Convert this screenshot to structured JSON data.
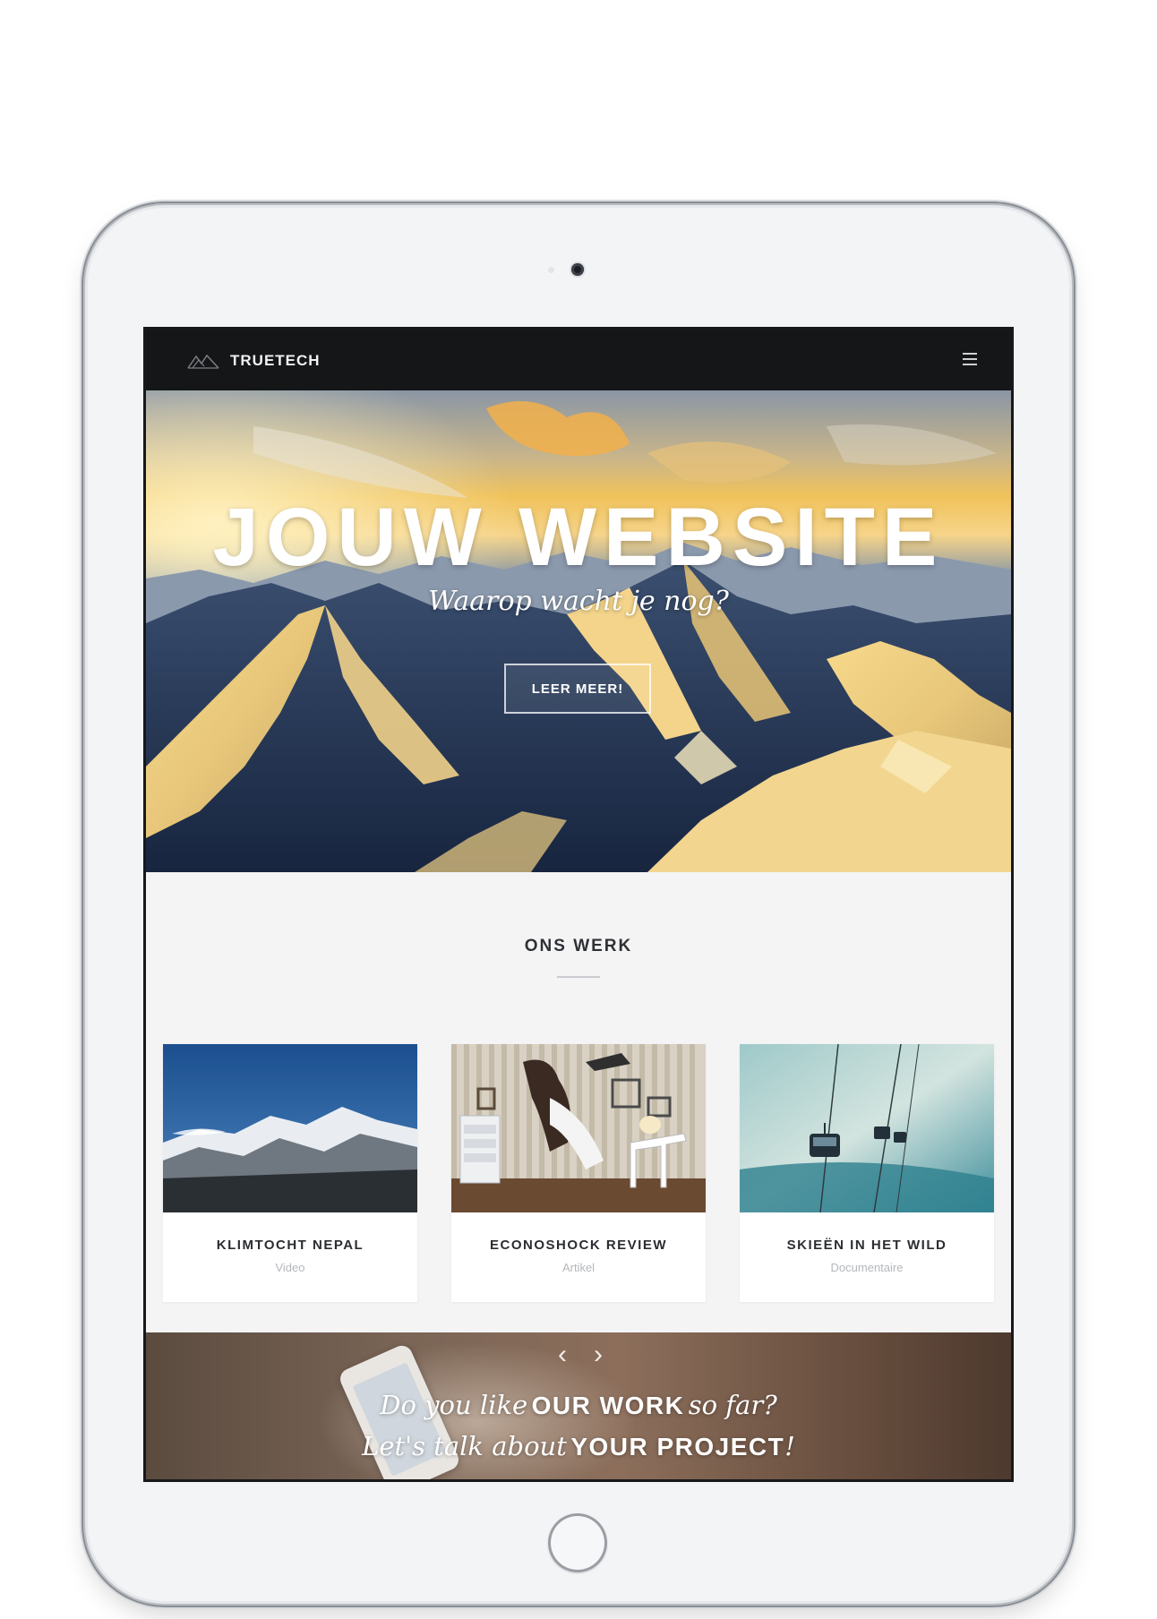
{
  "navbar": {
    "brand": "TRUETECH",
    "logo_icon": "mountain-logo-icon",
    "menu_icon": "hamburger-menu-icon"
  },
  "hero": {
    "title": "JOUW WEBSITE",
    "subtitle": "Waarop wacht je nog?",
    "button_label": "LEER MEER!"
  },
  "work": {
    "title": "ONS WERK",
    "cards": [
      {
        "title": "KLIMTOCHT NEPAL",
        "category": "Video"
      },
      {
        "title": "ECONOSHOCK REVIEW",
        "category": "Artikel"
      },
      {
        "title": "SKIEËN IN HET WILD",
        "category": "Documentaire"
      }
    ]
  },
  "cta": {
    "prev_icon": "chevron-left-icon",
    "next_icon": "chevron-right-icon",
    "line1_a": "Do you like",
    "line1_b": "OUR WORK",
    "line1_c": "so far?",
    "line2_a": "Let's talk about",
    "line2_b": "YOUR PROJECT",
    "line2_c": "!"
  },
  "colors": {
    "navbar_bg": "#151618",
    "section_bg": "#f4f4f5",
    "card_bg": "#ffffff",
    "text_dark": "#2b2d31",
    "text_muted": "#b5b7bb"
  }
}
